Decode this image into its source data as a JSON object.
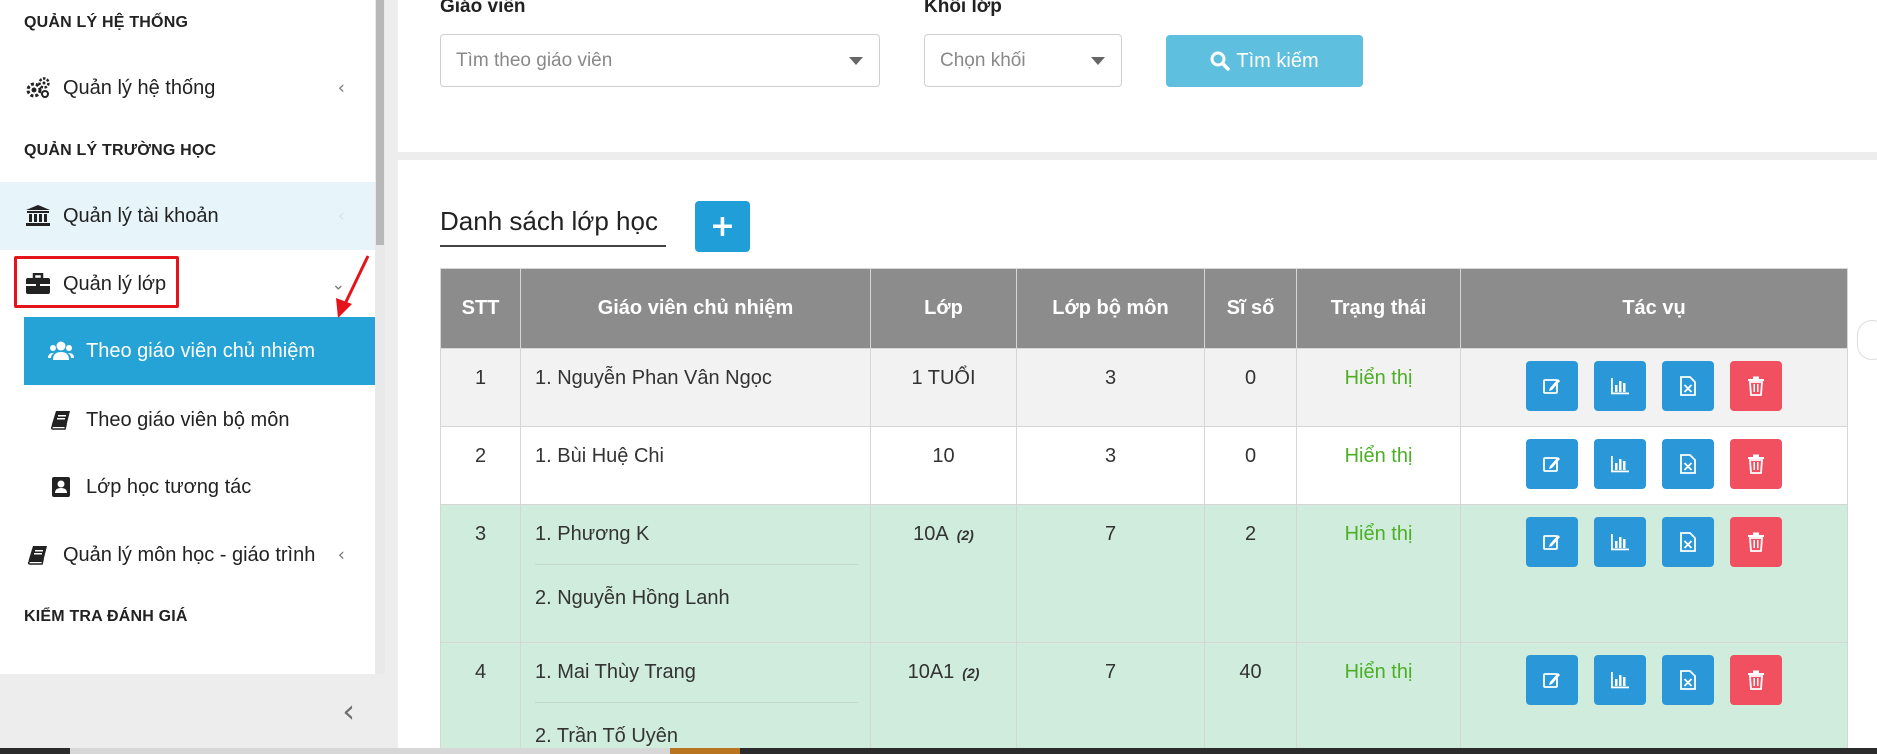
{
  "sidebar": {
    "sections": [
      {
        "label": "QUẢN LÝ HỆ THỐNG"
      },
      {
        "label": "QUẢN LÝ TRƯỜNG HỌC"
      },
      {
        "label": "KIỂM TRA ĐÁNH GIÁ"
      }
    ],
    "items": {
      "system": {
        "label": "Quản lý hệ thống",
        "icon": "gears-icon"
      },
      "accounts": {
        "label": "Quản lý tài khoản",
        "icon": "bank-icon"
      },
      "classes": {
        "label": "Quản lý lớp",
        "icon": "briefcase-icon"
      },
      "subjects": {
        "label": "Quản lý môn học - giáo trình",
        "icon": "book-icon"
      }
    },
    "class_sub": [
      {
        "label": "Theo giáo viên chủ nhiệm",
        "icon": "users-icon",
        "selected": true
      },
      {
        "label": "Theo giáo viên bộ môn",
        "icon": "book-icon",
        "selected": false
      },
      {
        "label": "Lớp học tương tác",
        "icon": "contact-card-icon",
        "selected": false
      }
    ]
  },
  "filters": {
    "teacher_label": "Giáo viên",
    "teacher_placeholder": "Tìm theo giáo viên",
    "grade_label": "Khối lớp",
    "grade_placeholder": "Chọn khối",
    "search_button": "Tìm kiếm"
  },
  "list": {
    "title": "Danh sách lớp học",
    "add_button": "+",
    "columns": [
      "STT",
      "Giáo viên chủ nhiệm",
      "Lớp",
      "Lớp bộ môn",
      "Sĩ số",
      "Trạng thái",
      "Tác vụ"
    ],
    "rows": [
      {
        "stt": "1",
        "teachers": [
          "1. Nguyễn Phan Vân Ngọc"
        ],
        "class": "1 TUỔI",
        "count": "",
        "subject_classes": "3",
        "students": "0",
        "status": "Hiển thị"
      },
      {
        "stt": "2",
        "teachers": [
          "1. Bùi Huệ Chi"
        ],
        "class": "10",
        "count": "",
        "subject_classes": "3",
        "students": "0",
        "status": "Hiển thị"
      },
      {
        "stt": "3",
        "teachers": [
          "1. Phương K",
          "2. Nguyễn Hồng Lanh"
        ],
        "class": "10A",
        "count": "(2)",
        "subject_classes": "7",
        "students": "2",
        "status": "Hiển thị"
      },
      {
        "stt": "4",
        "teachers": [
          "1. Mai Thùy Trang",
          "2. Trần Tố Uyên"
        ],
        "class": "10A1",
        "count": "(2)",
        "subject_classes": "7",
        "students": "40",
        "status": "Hiển thị"
      }
    ]
  },
  "colors": {
    "primary": "#26a3d6",
    "header_bg": "#8c8c8c",
    "status_green": "#4caf25",
    "delete_red": "#f05060",
    "row_green": "#cfecdc",
    "highlight_red": "#e5141b"
  }
}
